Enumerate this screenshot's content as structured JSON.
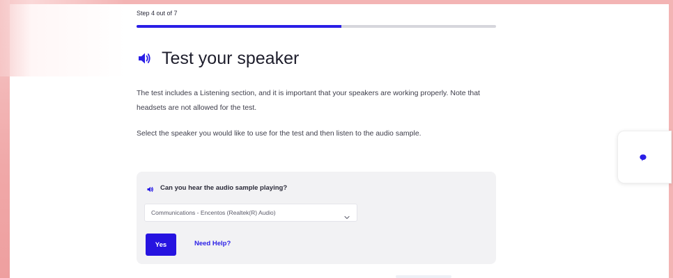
{
  "header": {
    "step_label": "Step 4 out of 7",
    "progress": 0.57
  },
  "main": {
    "title": "Test your speaker",
    "title_icon": "speaker-icon",
    "paragraphs": [
      "The test includes a Listening section, and it is important that your speakers are working properly. Note that headsets are not allowed for the test.",
      "Select the speaker you would like to use for the test and then listen to the audio sample."
    ]
  },
  "card": {
    "question_icon": "speaker-icon",
    "question": "Can you hear the audio sample playing?",
    "speaker_select": {
      "value": "Communications - Encentos (Realtek(R) Audio)"
    },
    "yes_label": "Yes",
    "help_label": "Need Help?"
  },
  "chat_widget": {
    "icon": "chat-bubble-icon"
  },
  "colors": {
    "accent": "#2a1ee6",
    "background_pink": "#f3b4b4",
    "card_bg": "#f2f2f4"
  }
}
